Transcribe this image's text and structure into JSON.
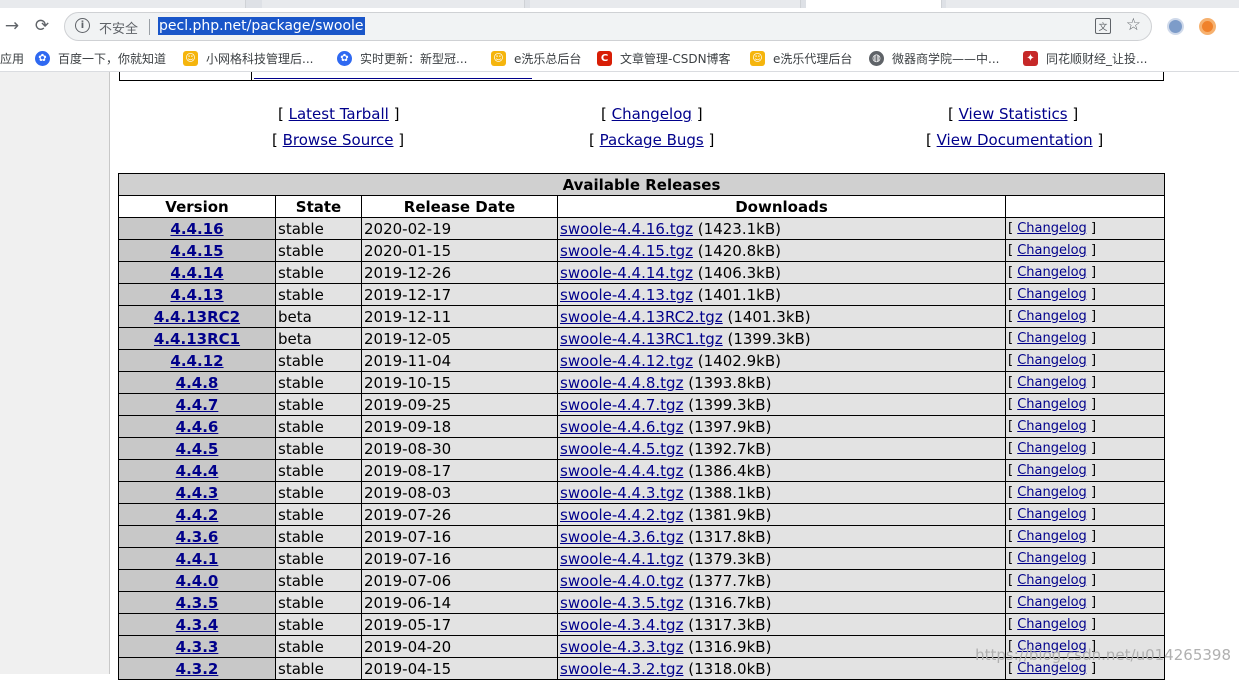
{
  "browser": {
    "address": {
      "security_label": "不安全",
      "url": "pecl.php.net/package/swoole"
    },
    "bookmarks": [
      {
        "label": "应用",
        "icon": "apps-icon"
      },
      {
        "label": "百度一下，你就知道",
        "icon": "baidu-paw-icon"
      },
      {
        "label": "小网格科技管理后...",
        "icon": "yellow-bell-icon"
      },
      {
        "label": "实时更新：新型冠...",
        "icon": "baidu-paw-icon"
      },
      {
        "label": "e洗乐总后台",
        "icon": "yellow-bell-icon"
      },
      {
        "label": "文章管理-CSDN博客",
        "icon": "csdn-c-icon"
      },
      {
        "label": "e洗乐代理后台",
        "icon": "yellow-bell-icon"
      },
      {
        "label": "微器商学院——中...",
        "icon": "globe-icon"
      },
      {
        "label": "同花顺财经_让投...",
        "icon": "tonghuashun-icon"
      }
    ]
  },
  "package_links": [
    {
      "label": "Latest Tarball"
    },
    {
      "label": "Changelog"
    },
    {
      "label": "View Statistics"
    },
    {
      "label": "Browse Source"
    },
    {
      "label": "Package Bugs"
    },
    {
      "label": "View Documentation"
    }
  ],
  "releases": {
    "caption": "Available Releases",
    "headers": [
      "Version",
      "State",
      "Release Date",
      "Downloads",
      ""
    ],
    "changelog_label": "Changelog",
    "rows": [
      {
        "version": "4.4.16",
        "state": "stable",
        "date": "2020-02-19",
        "file": "swoole-4.4.16.tgz",
        "size": "(1423.1kB)"
      },
      {
        "version": "4.4.15",
        "state": "stable",
        "date": "2020-01-15",
        "file": "swoole-4.4.15.tgz",
        "size": "(1420.8kB)"
      },
      {
        "version": "4.4.14",
        "state": "stable",
        "date": "2019-12-26",
        "file": "swoole-4.4.14.tgz",
        "size": "(1406.3kB)"
      },
      {
        "version": "4.4.13",
        "state": "stable",
        "date": "2019-12-17",
        "file": "swoole-4.4.13.tgz",
        "size": "(1401.1kB)"
      },
      {
        "version": "4.4.13RC2",
        "state": "beta",
        "date": "2019-12-11",
        "file": "swoole-4.4.13RC2.tgz",
        "size": "(1401.3kB)"
      },
      {
        "version": "4.4.13RC1",
        "state": "beta",
        "date": "2019-12-05",
        "file": "swoole-4.4.13RC1.tgz",
        "size": "(1399.3kB)"
      },
      {
        "version": "4.4.12",
        "state": "stable",
        "date": "2019-11-04",
        "file": "swoole-4.4.12.tgz",
        "size": "(1402.9kB)"
      },
      {
        "version": "4.4.8",
        "state": "stable",
        "date": "2019-10-15",
        "file": "swoole-4.4.8.tgz",
        "size": "(1393.8kB)"
      },
      {
        "version": "4.4.7",
        "state": "stable",
        "date": "2019-09-25",
        "file": "swoole-4.4.7.tgz",
        "size": "(1399.3kB)"
      },
      {
        "version": "4.4.6",
        "state": "stable",
        "date": "2019-09-18",
        "file": "swoole-4.4.6.tgz",
        "size": "(1397.9kB)"
      },
      {
        "version": "4.4.5",
        "state": "stable",
        "date": "2019-08-30",
        "file": "swoole-4.4.5.tgz",
        "size": "(1392.7kB)"
      },
      {
        "version": "4.4.4",
        "state": "stable",
        "date": "2019-08-17",
        "file": "swoole-4.4.4.tgz",
        "size": "(1386.4kB)"
      },
      {
        "version": "4.4.3",
        "state": "stable",
        "date": "2019-08-03",
        "file": "swoole-4.4.3.tgz",
        "size": "(1388.1kB)"
      },
      {
        "version": "4.4.2",
        "state": "stable",
        "date": "2019-07-26",
        "file": "swoole-4.4.2.tgz",
        "size": "(1381.9kB)"
      },
      {
        "version": "4.3.6",
        "state": "stable",
        "date": "2019-07-16",
        "file": "swoole-4.3.6.tgz",
        "size": "(1317.8kB)"
      },
      {
        "version": "4.4.1",
        "state": "stable",
        "date": "2019-07-16",
        "file": "swoole-4.4.1.tgz",
        "size": "(1379.3kB)"
      },
      {
        "version": "4.4.0",
        "state": "stable",
        "date": "2019-07-06",
        "file": "swoole-4.4.0.tgz",
        "size": "(1377.7kB)"
      },
      {
        "version": "4.3.5",
        "state": "stable",
        "date": "2019-06-14",
        "file": "swoole-4.3.5.tgz",
        "size": "(1316.7kB)"
      },
      {
        "version": "4.3.4",
        "state": "stable",
        "date": "2019-05-17",
        "file": "swoole-4.3.4.tgz",
        "size": "(1317.3kB)"
      },
      {
        "version": "4.3.3",
        "state": "stable",
        "date": "2019-04-20",
        "file": "swoole-4.3.3.tgz",
        "size": "(1316.9kB)"
      },
      {
        "version": "4.3.2",
        "state": "stable",
        "date": "2019-04-15",
        "file": "swoole-4.3.2.tgz",
        "size": "(1318.0kB)"
      }
    ]
  },
  "watermark": "https://blog.csdn.net/u014265398"
}
